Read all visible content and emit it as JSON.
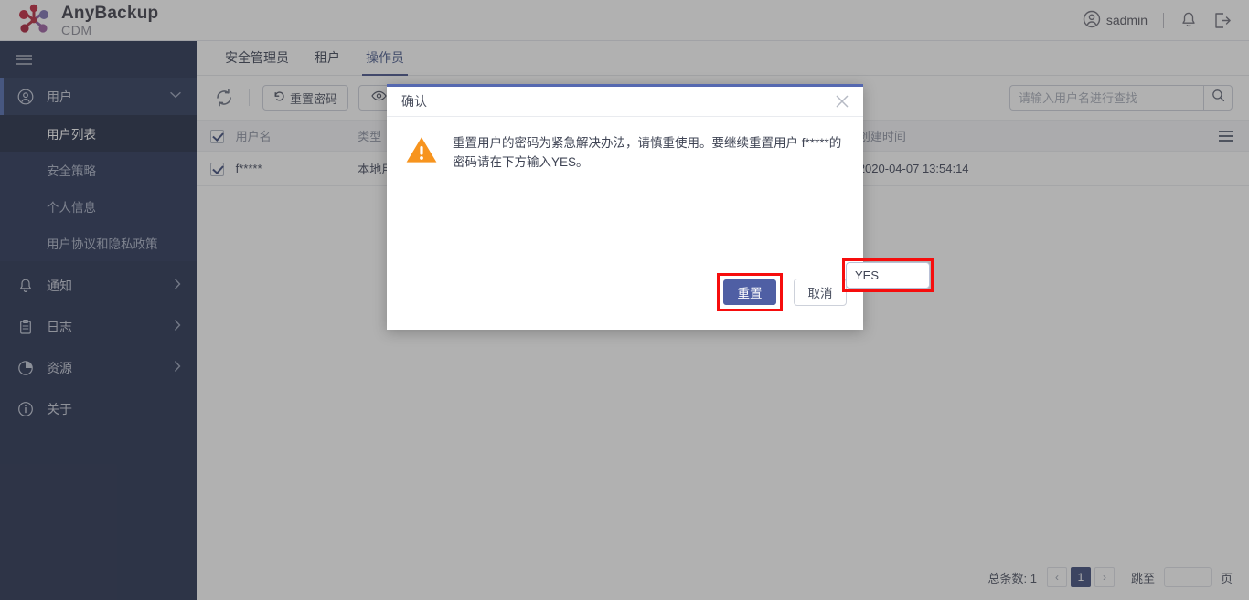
{
  "brand": {
    "title": "AnyBackup",
    "subtitle": "CDM"
  },
  "header": {
    "username": "sadmin",
    "user_icon": "user-circle-icon",
    "notification_icon": "bell-icon",
    "logout_icon": "logout-icon",
    "separator": "|"
  },
  "sidebar": {
    "menu_icon": "hamburger-icon",
    "items": [
      {
        "label": "用户",
        "icon": "user-circle-icon",
        "arrow": "chevron-down-icon",
        "expanded": true,
        "active": true,
        "children": [
          {
            "label": "用户列表",
            "active": true
          },
          {
            "label": "安全策略",
            "active": false
          },
          {
            "label": "个人信息",
            "active": false
          },
          {
            "label": "用户协议和隐私政策",
            "active": false
          }
        ]
      },
      {
        "label": "通知",
        "icon": "bell-icon",
        "arrow": "chevron-right-icon",
        "expanded": false,
        "active": false
      },
      {
        "label": "日志",
        "icon": "clipboard-icon",
        "arrow": "chevron-right-icon",
        "expanded": false,
        "active": false
      },
      {
        "label": "资源",
        "icon": "pie-chart-icon",
        "arrow": "chevron-right-icon",
        "expanded": false,
        "active": false
      },
      {
        "label": "关于",
        "icon": "info-circle-icon",
        "arrow": "",
        "expanded": false,
        "active": false
      }
    ]
  },
  "tabs": [
    {
      "label": "安全管理员",
      "active": false
    },
    {
      "label": "租户",
      "active": false
    },
    {
      "label": "操作员",
      "active": true
    }
  ],
  "toolbar": {
    "refresh_icon": "refresh-icon",
    "reset_password_label": "重置密码",
    "reset_password_icon": "undo-arrow-icon",
    "eye_icon": "eye-icon"
  },
  "search": {
    "placeholder": "请输入用户名进行查找",
    "value": "",
    "icon": "search-icon"
  },
  "table": {
    "headers": [
      "用户名",
      "类型",
      "",
      "创建时间"
    ],
    "menu_icon": "list-menu-icon",
    "header_checked": true,
    "rows": [
      {
        "checked": true,
        "username": "f*****",
        "type": "本地用户",
        "mid": "",
        "created": "2020-04-07 13:54:14"
      }
    ]
  },
  "pagination": {
    "total_label": "总条数: 1",
    "prev": "‹",
    "next": "›",
    "current_page": "1",
    "jump_label": "跳至",
    "jump_value": "",
    "page_unit": "页"
  },
  "modal": {
    "title": "确认",
    "close_icon": "close-icon",
    "warning_icon": "warning-triangle-icon",
    "message": "重置用户的密码为紧急解决办法，请慎重使用。要继续重置用户 f*****的密码请在下方输入YES。",
    "input_value": "YES",
    "confirm_label": "重置",
    "cancel_label": "取消"
  },
  "colors": {
    "sidebar_bg": "#242f4f",
    "accent": "#4f5fa4",
    "warning": "#f7941e",
    "highlight_border": "#f60d0d",
    "tab_active": "#47538a"
  }
}
